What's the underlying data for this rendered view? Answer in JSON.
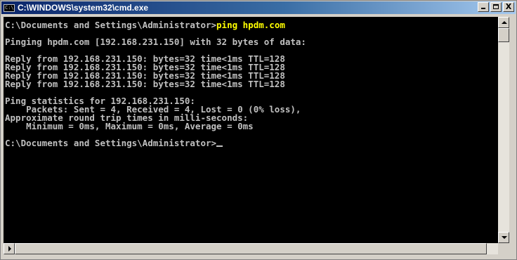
{
  "window": {
    "title": "C:\\WINDOWS\\system32\\cmd.exe",
    "icon_label": "C:\\",
    "icon_name": "cmd-console-icon"
  },
  "caption_buttons": {
    "minimize": "minimize-icon",
    "maximize": "maximize-icon",
    "close_glyph": "X"
  },
  "console": {
    "lines": [
      {
        "prompt": "C:\\Documents and Settings\\Administrator>",
        "command": "ping hpdm.com"
      },
      {
        "text": "Pinging hpdm.com [192.168.231.150] with 32 bytes of data:"
      },
      {
        "text": "Reply from 192.168.231.150: bytes=32 time<1ms TTL=128"
      },
      {
        "text": "Reply from 192.168.231.150: bytes=32 time<1ms TTL=128"
      },
      {
        "text": "Reply from 192.168.231.150: bytes=32 time<1ms TTL=128"
      },
      {
        "text": "Reply from 192.168.231.150: bytes=32 time<1ms TTL=128"
      },
      {
        "text": "Ping statistics for 192.168.231.150:"
      },
      {
        "text": "    Packets: Sent = 4, Received = 4, Lost = 0 (0% loss),"
      },
      {
        "text": "Approximate round trip times in milli-seconds:"
      },
      {
        "text": "    Minimum = 0ms, Maximum = 0ms, Average = 0ms"
      },
      {
        "prompt": "C:\\Documents and Settings\\Administrator>"
      }
    ]
  },
  "colors": {
    "background": "#000000",
    "text": "#c0c0c0",
    "command": "#ffff00",
    "titlebar_start": "#0a246a",
    "titlebar_end": "#a6caf0"
  }
}
